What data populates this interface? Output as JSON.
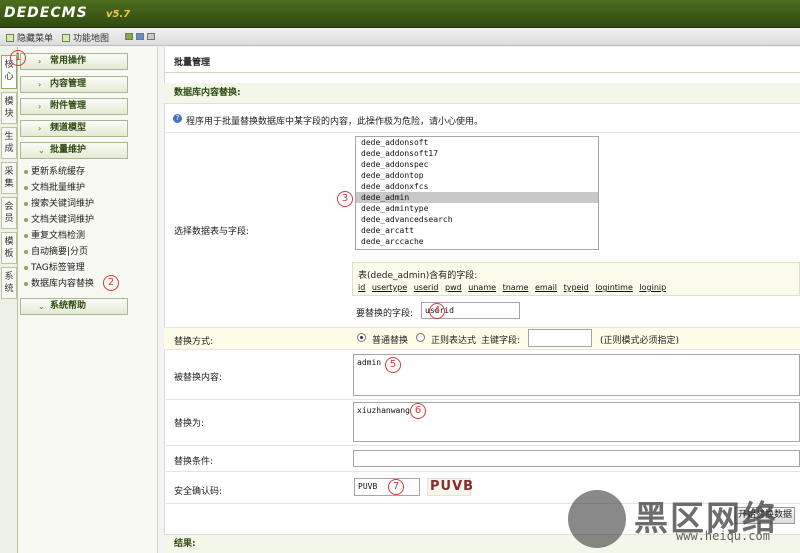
{
  "header": {
    "logo": "DEDECMS",
    "version": "v5.7"
  },
  "toolbar": {
    "hide_menu": "隐藏菜单",
    "site_map": "功能地图"
  },
  "vtabs": [
    "核心",
    "模块",
    "生成",
    "采集",
    "会员",
    "模板",
    "系统"
  ],
  "menu": {
    "categories": [
      "常用操作",
      "内容管理",
      "附件管理",
      "频道模型",
      "批量维护"
    ],
    "items": [
      "更新系统缓存",
      "文档批量维护",
      "搜索关键词维护",
      "文档关键词维护",
      "重复文档检测",
      "自动摘要|分页",
      "TAG标签管理",
      "数据库内容替换"
    ],
    "help": "系统帮助"
  },
  "main": {
    "title": "批量管理",
    "section": "数据库内容替换:",
    "notice": "程序用于批量替换数据库中某字段的内容，此操作极为危险，请小心使用。",
    "select_label": "选择数据表与字段:",
    "tables": [
      "dede_addonsoft",
      "dede_addonsoft17",
      "dede_addonspec",
      "dede_addontop",
      "dede_addonxfcs",
      "dede_admin",
      "dede_admintype",
      "dede_advancedsearch",
      "dede_arcatt",
      "dede_arccache"
    ],
    "selected_table": "dede_admin",
    "fields_title": "表(dede_admin)含有的字段:",
    "fields": [
      "id",
      "usertype",
      "userid",
      "pwd",
      "uname",
      "tname",
      "email",
      "typeid",
      "logintime",
      "loginip"
    ],
    "field_label": "要替换的字段:",
    "field_value": "userid",
    "mode_label": "替换方式:",
    "mode_normal": "普通替换",
    "mode_regex": "正则表达式",
    "key_field_label": "主键字段:",
    "regex_hint": "(正则模式必须指定)",
    "find_label": "被替换内容:",
    "find_value": "admin",
    "replace_label": "替换为:",
    "replace_value": "xiuzhanwang",
    "condition_label": "替换条件:",
    "captcha_label": "安全确认码:",
    "captcha_value": "PUVB",
    "captcha_image": "PUVB",
    "submit": "开始替换数据",
    "result_label": "结果:"
  },
  "annotations": [
    "1",
    "2",
    "3",
    "4",
    "5",
    "6",
    "7"
  ],
  "watermark": {
    "text": "黑区网络",
    "url": "www.heiqu.com"
  },
  "colors": {
    "brand": "#3d5c18",
    "highlight": "#fdfde8",
    "annotation": "#d23a3a"
  }
}
